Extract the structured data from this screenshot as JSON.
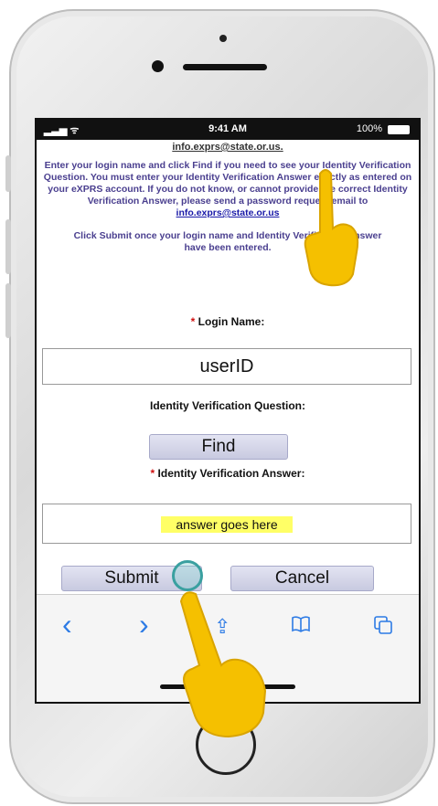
{
  "status_bar": {
    "signal": "▂▃▅ ᯤ",
    "time": "9:41 AM",
    "battery": "100%"
  },
  "page": {
    "email_top": "info.exprs@state.or.us.",
    "instructions_1_a": "Enter your login name and click Find if you need to see your Identity Verification Question. You must enter your Identity Verification Answer exactly as entered on your eXPRS account. If you do not know, or cannot provide the correct Identity Verification Answer, please send a password request email to ",
    "instructions_1_link": "info.exprs@state.or.us",
    "instructions_2": "Click Submit once your login name and Identity Verification Answer have been entered.",
    "required_mark": "*",
    "login_label": "Login Name:",
    "login_value": "userID",
    "question_label": "Identity Verification Question:",
    "find_label": "Find",
    "answer_label": "Identity Verification Answer:",
    "answer_value": "answer goes here",
    "submit_label": "Submit",
    "cancel_label": "Cancel"
  },
  "toolbar": {
    "back_icon": "‹",
    "forward_icon": "›",
    "share_icon": "⇪",
    "bookmarks_icon": "📖",
    "tabs_icon": "⧉"
  },
  "colors": {
    "instructions": "#4a3f8f",
    "link": "#1a1aa8",
    "required": "#d01010",
    "highlight": "#ffff66",
    "button": "#c8cae0",
    "toolbar_icons": "#2d7be5",
    "hand": "#f5c000"
  }
}
